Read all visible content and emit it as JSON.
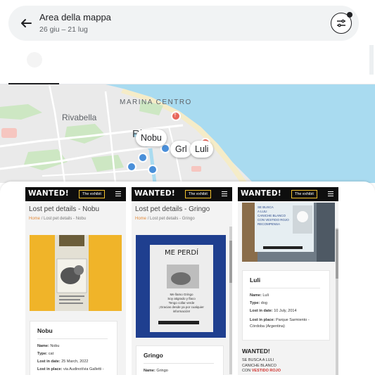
{
  "search": {
    "title": "Area della mappa",
    "subtitle": "26 giu – 21 lug"
  },
  "map": {
    "labels": {
      "town": "Rivabella",
      "district": "MARINA CENTRO",
      "city_fragment": "Ri"
    },
    "markers": [
      "Nobu",
      "Grl",
      "Luli"
    ],
    "colors": {
      "sea": "#a9dbf0",
      "land": "#eaeaea",
      "park": "#cde7c3",
      "beach": "#f5ecc8"
    }
  },
  "cards": [
    {
      "site": {
        "logo": "WANTED!",
        "exhibit": "The exhibit"
      },
      "heading": "Lost pet details - Nobu",
      "crumbs": {
        "home": "Home",
        "sep": "/",
        "current": "Lost pet details - Nobu"
      },
      "name": "Nobu",
      "fields": [
        {
          "label": "Name:",
          "value": "Nobu"
        },
        {
          "label": "Type:",
          "value": "cat"
        },
        {
          "label": "Lost in date:",
          "value": "25 March, 2022"
        },
        {
          "label": "Lost in place:",
          "value": "via Audinot/via Galletti -"
        }
      ]
    },
    {
      "site": {
        "logo": "WANTED!",
        "exhibit": "The exhibit"
      },
      "heading": "Lost pet details - Gringo",
      "crumbs": {
        "home": "Home",
        "sep": "/",
        "current": "Lost pet details - Gringo"
      },
      "poster": {
        "title": "ME PERDÍ",
        "lines": [
          "Me llamo Gringo",
          "Soy atigrado y flaco",
          "Tengo collar verde",
          "¡Gracias desde ya por cualquier",
          "información!"
        ]
      },
      "name": "Gringo",
      "fields": [
        {
          "label": "Name:",
          "value": "Gringo"
        }
      ]
    },
    {
      "site": {
        "logo": "WANTED!",
        "exhibit": "The exhibit"
      },
      "poster_lines": [
        "SE BUSCA",
        "A LULI",
        "CANICHE BLANCO",
        "CON VESTIDO ROJO",
        "RECOMPENSA"
      ],
      "name": "Luli",
      "fields": [
        {
          "label": "Name:",
          "value": "Luli"
        },
        {
          "label": "Type:",
          "value": "dog"
        },
        {
          "label": "Lost in date:",
          "value": "10 July, 2014"
        },
        {
          "label": "Lost in place:",
          "value": "Parque Sarmiento -"
        },
        {
          "label": "",
          "value": "Córdoba (Argentina)"
        }
      ],
      "wanted": {
        "heading": "WANTED!",
        "lines": [
          "SE BUSCA A LULI",
          "CANICHE BLANCO"
        ],
        "last_prefix": "CON ",
        "last_red": "VESTIDO ROJO"
      }
    }
  ]
}
